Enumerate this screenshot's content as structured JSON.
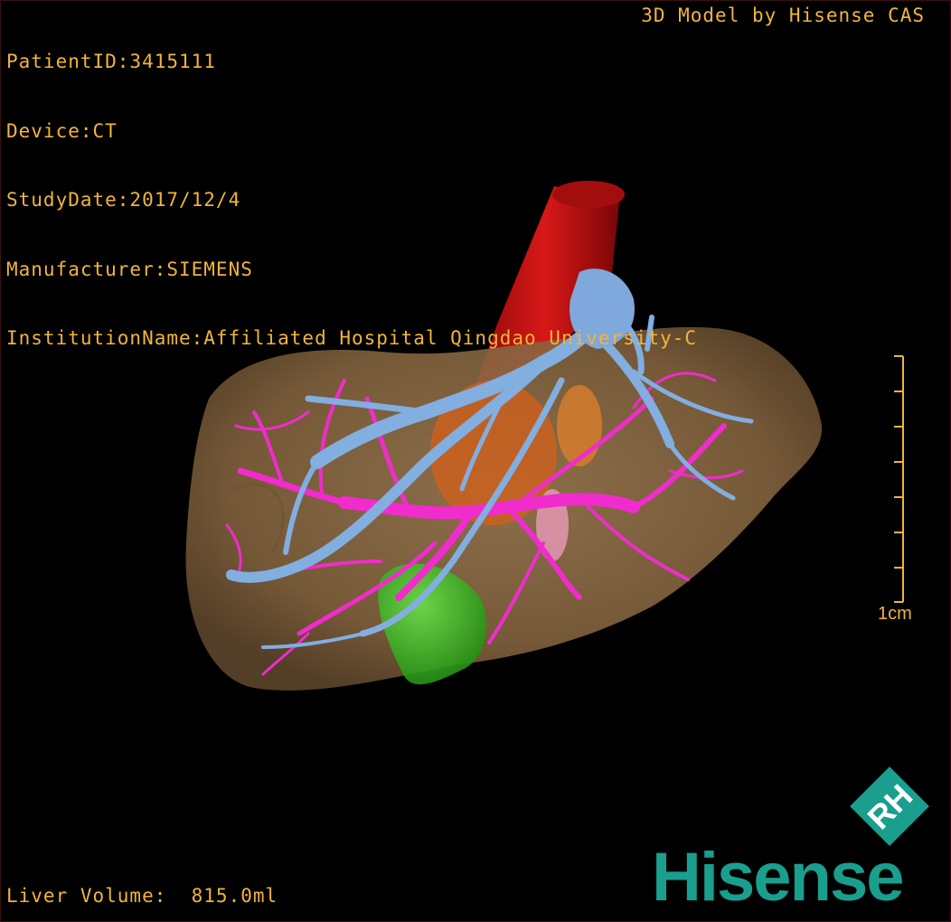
{
  "header": {
    "patient_id": "PatientID:3415111",
    "device": "Device:CT",
    "study_date": "StudyDate:2017/12/4",
    "manufacturer": "Manufacturer:SIEMENS",
    "institution": "InstitutionName:Affiliated Hospital Qingdao University-C"
  },
  "credit": "3D Model by Hisense CAS",
  "measurement": {
    "liver_volume": "Liver Volume:  815.0ml"
  },
  "scale_bar": {
    "label": "1cm"
  },
  "brand": {
    "name": "Hisense",
    "monogram": "RH",
    "color": "#1a9e8e"
  },
  "model": {
    "structures": [
      {
        "name": "liver",
        "color": "#8a6a45"
      },
      {
        "name": "aorta",
        "color": "#c41010"
      },
      {
        "name": "vein",
        "color": "#7fa8dc"
      },
      {
        "name": "portal-vessels",
        "color": "#f02ccc"
      },
      {
        "name": "gallbladder",
        "color": "#34b51d"
      },
      {
        "name": "lesion",
        "color": "#e07020"
      }
    ]
  },
  "colors": {
    "overlay_text": "#f0b53a",
    "background": "#000000"
  }
}
